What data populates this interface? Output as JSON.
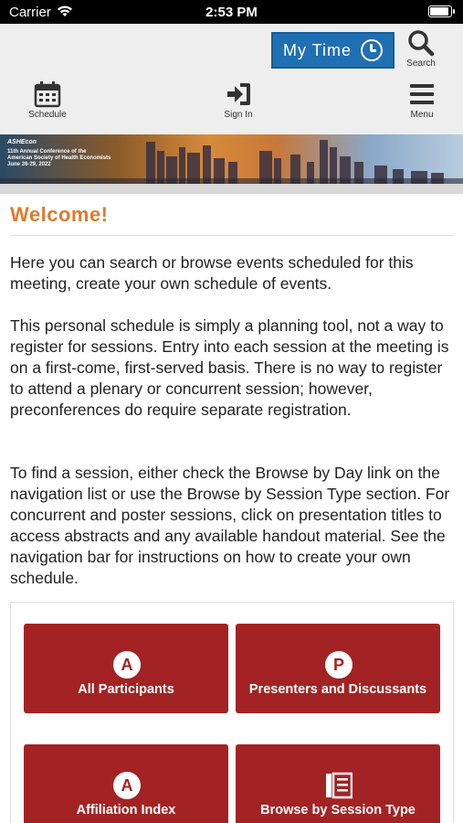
{
  "status_bar": {
    "carrier": "Carrier",
    "time": "2:53 PM",
    "battery_level": 1.0
  },
  "header": {
    "mytime_label": "My Time",
    "search_label": "Search",
    "nav": {
      "schedule": "Schedule",
      "sign_in": "Sign In",
      "menu": "Menu"
    },
    "icons": {
      "mytime": "clock-icon",
      "search": "search-icon",
      "schedule": "calendar-icon",
      "sign_in": "sign-in-icon",
      "menu": "hamburger-icon"
    },
    "accent_color": "#1f6fb3"
  },
  "banner": {
    "org": "ASHEcon",
    "conference_line1": "11th Annual Conference of the",
    "conference_line2": "American Society of Health Economists",
    "dates": "June 26-29, 2022"
  },
  "main": {
    "heading": "Welcome!",
    "heading_color": "#e07a2e",
    "paragraphs": [
      "Here you can search or browse events scheduled for this meeting, create your own schedule of events.",
      "This personal schedule is simply a planning tool, not a way to register for sessions. Entry into each session at the meeting is on a first-come, first-served basis. There is no way to register to attend a plenary or concurrent session; however, preconferences do require separate registration.",
      "To find a session, either check the Browse by Day link on the navigation list or use the Browse by Session Type section. For concurrent and poster sessions, click on presentation titles to access abstracts and any available handout material. See the navigation bar for instructions on how to create your own schedule."
    ]
  },
  "tiles": {
    "color": "#a32324",
    "items": [
      {
        "label": "All Participants",
        "badge": "A",
        "icon": "letter-a-icon"
      },
      {
        "label": "Presenters and Discussants",
        "badge": "P",
        "icon": "letter-p-icon"
      },
      {
        "label": "Affiliation Index",
        "badge": "A",
        "icon": "letter-a-icon"
      },
      {
        "label": "Browse by Session Type",
        "badge": "",
        "icon": "session-type-icon"
      }
    ]
  }
}
